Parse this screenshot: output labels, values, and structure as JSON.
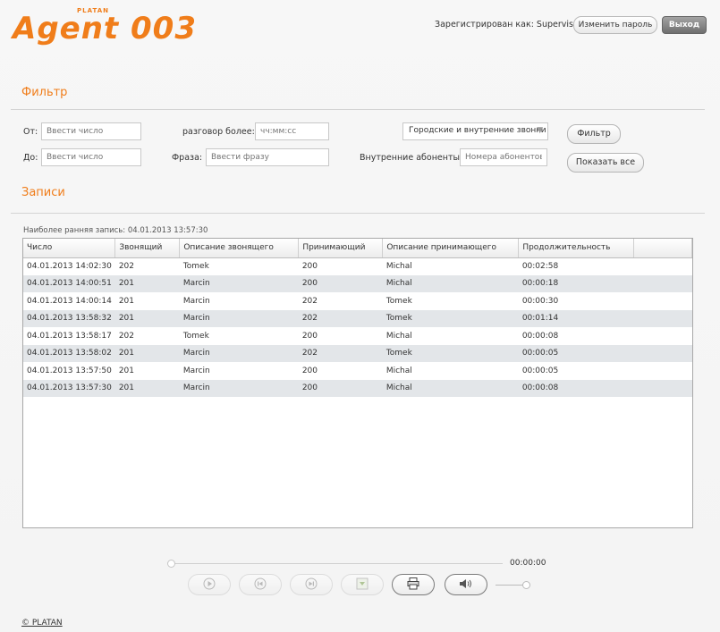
{
  "header": {
    "logo_small": "PLATAN",
    "logo": "Agent 003",
    "logged_in_as": "Зарегистрирован как: Supervisor",
    "change_password": "Изменить пароль",
    "logout": "Выход"
  },
  "filter": {
    "title": "Фильтр",
    "from_label": "От:",
    "from_placeholder": "Ввести число",
    "to_label": "До:",
    "to_placeholder": "Ввести число",
    "duration_label": "разговор более:",
    "duration_placeholder": "чч:мм:сс",
    "phrase_label": "Фраза:",
    "phrase_placeholder": "Ввести фразу",
    "call_type_selected": "Городские и внутренние звонки",
    "internal_label": "Внутренние абоненты:",
    "internal_placeholder": "Номера абонентов",
    "filter_button": "Фильтр",
    "show_all_button": "Показать все"
  },
  "records": {
    "title": "Записи",
    "earliest": "Наиболее ранняя запись: 04.01.2013 13:57:30",
    "columns": [
      "Число",
      "Звонящий",
      "Описание звонящего",
      "Принимающий",
      "Описание принимающего",
      "Продолжительность",
      ""
    ],
    "rows": [
      [
        "04.01.2013 14:02:30",
        "202",
        "Tomek",
        "200",
        "Michal",
        "00:02:58"
      ],
      [
        "04.01.2013 14:00:51",
        "201",
        "Marcin",
        "200",
        "Michal",
        "00:00:18"
      ],
      [
        "04.01.2013 14:00:14",
        "201",
        "Marcin",
        "202",
        "Tomek",
        "00:00:30"
      ],
      [
        "04.01.2013 13:58:32",
        "201",
        "Marcin",
        "202",
        "Tomek",
        "00:01:14"
      ],
      [
        "04.01.2013 13:58:17",
        "202",
        "Tomek",
        "200",
        "Michal",
        "00:00:08"
      ],
      [
        "04.01.2013 13:58:02",
        "201",
        "Marcin",
        "202",
        "Tomek",
        "00:00:05"
      ],
      [
        "04.01.2013 13:57:50",
        "201",
        "Marcin",
        "200",
        "Michal",
        "00:00:05"
      ],
      [
        "04.01.2013 13:57:30",
        "201",
        "Marcin",
        "200",
        "Michal",
        "00:00:08"
      ]
    ]
  },
  "player": {
    "time": "00:00:00",
    "progress": 0,
    "volume": 1,
    "buttons": [
      "play-icon",
      "rewind-icon",
      "forward-icon",
      "download-icon",
      "print-icon",
      "volume-icon"
    ]
  },
  "footer": {
    "copyright": "© PLATAN"
  },
  "colors": {
    "accent": "#f07d1a",
    "row_alt": "#e3e6e9"
  }
}
